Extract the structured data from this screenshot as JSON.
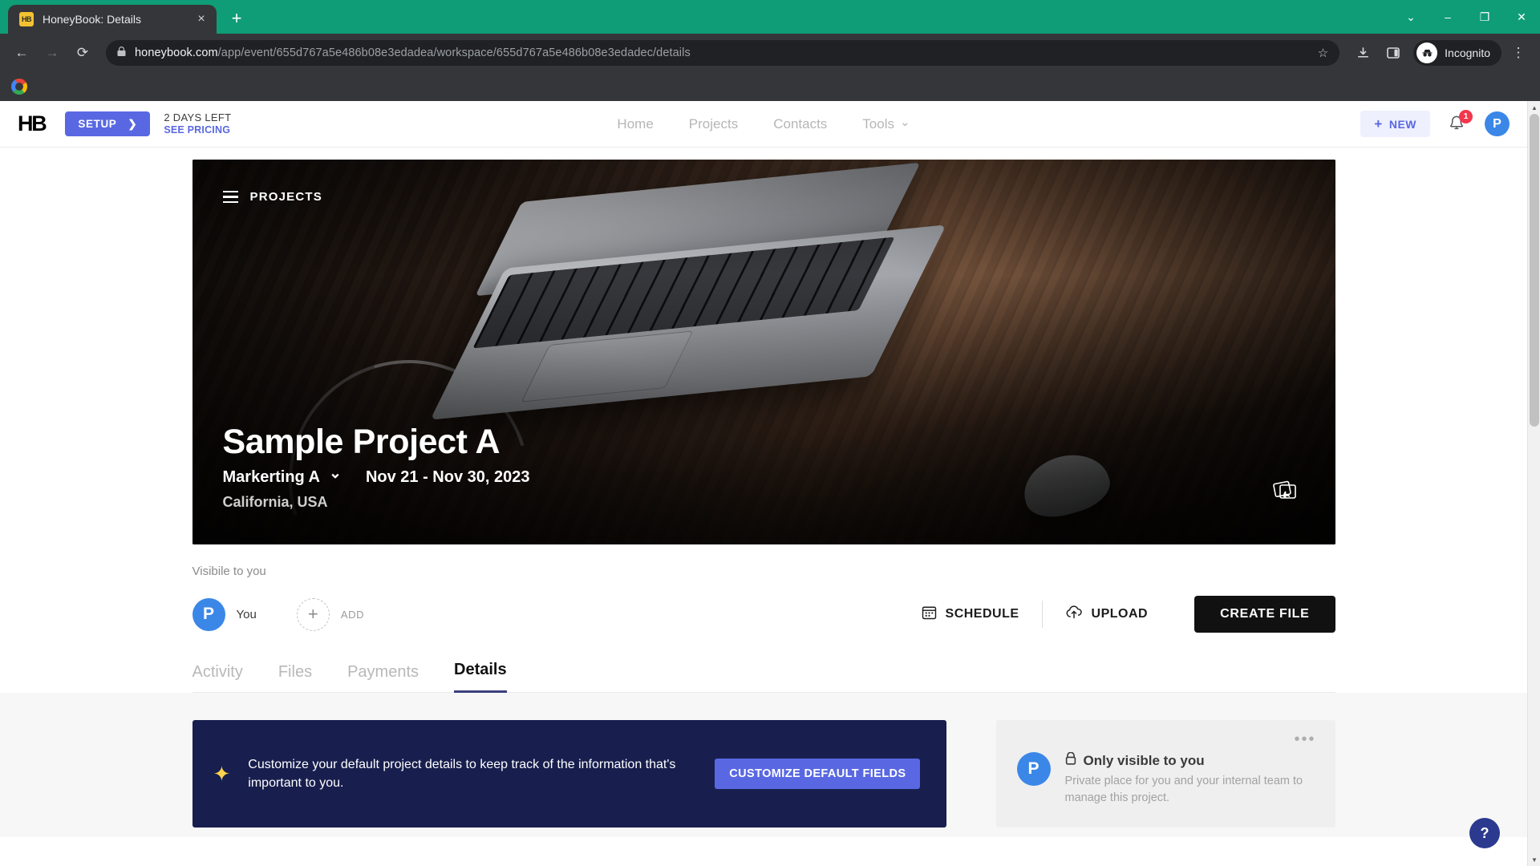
{
  "browser": {
    "tab": {
      "title": "HoneyBook: Details",
      "favicon_text": "HB",
      "close_icon": "×"
    },
    "new_tab_icon": "+",
    "window_controls": {
      "minimize": "–",
      "maximize": "❐",
      "close": "✕",
      "chevron": "⌄"
    },
    "nav": {
      "back": "←",
      "forward": "→",
      "reload": "⟳"
    },
    "omnibox": {
      "lock_icon": "🔒",
      "url_domain": "honeybook.com",
      "url_path": "/app/event/655d767a5e486b08e3edadea/workspace/655d767a5e486b08e3edadec/details",
      "star_icon": "☆"
    },
    "toolbar_icons": {
      "download": "⬇",
      "sidepanel": "▣",
      "menu": "⋮"
    },
    "profile": {
      "label": "Incognito",
      "icon": "🕵"
    },
    "bookmarks": {
      "google_icon": "google-icon"
    }
  },
  "topnav": {
    "logo": "HB",
    "setup_label": "SETUP",
    "setup_chevron": "❯",
    "trial_days": "2 DAYS LEFT",
    "trial_pricing": "SEE PRICING",
    "links": [
      {
        "label": "Home"
      },
      {
        "label": "Projects"
      },
      {
        "label": "Contacts"
      },
      {
        "label": "Tools",
        "chevron": "⌄"
      }
    ],
    "new_button": {
      "plus": "+",
      "label": "NEW"
    },
    "notifications_count": "1",
    "avatar_initial": "P"
  },
  "hero": {
    "breadcrumb": "PROJECTS",
    "title": "Sample Project A",
    "client": "Markerting A",
    "client_chevron": "⌄",
    "dates": "Nov 21 - Nov 30, 2023",
    "location": "California, USA"
  },
  "visibility": {
    "label": "Visibile to you",
    "person_initial": "P",
    "person_name": "You",
    "add_plus": "+",
    "add_label": "ADD"
  },
  "actions": {
    "schedule": {
      "label": "SCHEDULE",
      "icon": "calendar-icon"
    },
    "upload": {
      "label": "UPLOAD",
      "icon": "cloud-upload-icon"
    },
    "create_file": {
      "label": "CREATE FILE"
    }
  },
  "tabs": [
    {
      "label": "Activity",
      "active": false
    },
    {
      "label": "Files",
      "active": false
    },
    {
      "label": "Payments",
      "active": false
    },
    {
      "label": "Details",
      "active": true
    }
  ],
  "promo": {
    "spark_icon": "✦",
    "text": "Customize your default project details to keep track of the information that's important to you.",
    "button_label": "CUSTOMIZE DEFAULT FIELDS"
  },
  "sidecard": {
    "dots": "•••",
    "avatar_initial": "P",
    "lock_icon": "🔒",
    "title": "Only visible to you",
    "subtitle": "Private place for you and your internal team to manage this project."
  },
  "help": {
    "label": "?"
  },
  "colors": {
    "brand_green": "#0f9d77",
    "accent_blue": "#5968e2",
    "avatar_blue": "#3b87e8",
    "badge_red": "#f4364c",
    "promo_navy": "#181f4e",
    "create_file_black": "#111111"
  }
}
